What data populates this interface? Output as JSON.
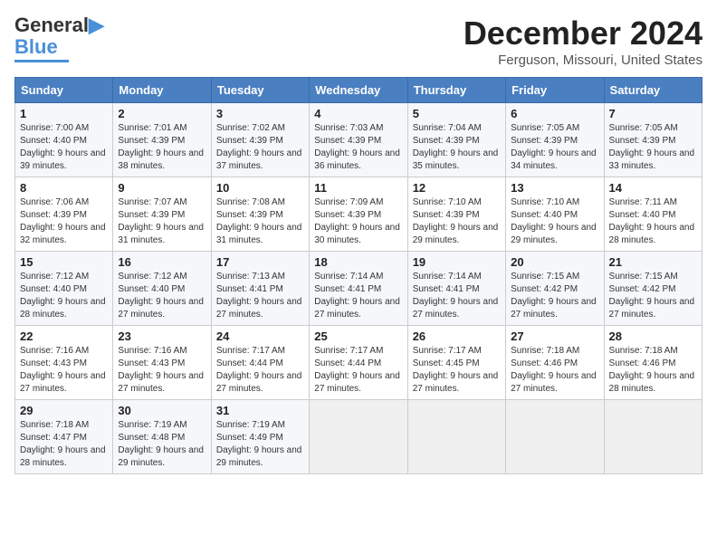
{
  "header": {
    "logo_line1": "General",
    "logo_line2": "Blue",
    "month_title": "December 2024",
    "location": "Ferguson, Missouri, United States"
  },
  "days_of_week": [
    "Sunday",
    "Monday",
    "Tuesday",
    "Wednesday",
    "Thursday",
    "Friday",
    "Saturday"
  ],
  "weeks": [
    [
      {
        "day": "1",
        "sunrise": "7:00 AM",
        "sunset": "4:40 PM",
        "daylight": "9 hours and 39 minutes."
      },
      {
        "day": "2",
        "sunrise": "7:01 AM",
        "sunset": "4:39 PM",
        "daylight": "9 hours and 38 minutes."
      },
      {
        "day": "3",
        "sunrise": "7:02 AM",
        "sunset": "4:39 PM",
        "daylight": "9 hours and 37 minutes."
      },
      {
        "day": "4",
        "sunrise": "7:03 AM",
        "sunset": "4:39 PM",
        "daylight": "9 hours and 36 minutes."
      },
      {
        "day": "5",
        "sunrise": "7:04 AM",
        "sunset": "4:39 PM",
        "daylight": "9 hours and 35 minutes."
      },
      {
        "day": "6",
        "sunrise": "7:05 AM",
        "sunset": "4:39 PM",
        "daylight": "9 hours and 34 minutes."
      },
      {
        "day": "7",
        "sunrise": "7:05 AM",
        "sunset": "4:39 PM",
        "daylight": "9 hours and 33 minutes."
      }
    ],
    [
      {
        "day": "8",
        "sunrise": "7:06 AM",
        "sunset": "4:39 PM",
        "daylight": "9 hours and 32 minutes."
      },
      {
        "day": "9",
        "sunrise": "7:07 AM",
        "sunset": "4:39 PM",
        "daylight": "9 hours and 31 minutes."
      },
      {
        "day": "10",
        "sunrise": "7:08 AM",
        "sunset": "4:39 PM",
        "daylight": "9 hours and 31 minutes."
      },
      {
        "day": "11",
        "sunrise": "7:09 AM",
        "sunset": "4:39 PM",
        "daylight": "9 hours and 30 minutes."
      },
      {
        "day": "12",
        "sunrise": "7:10 AM",
        "sunset": "4:39 PM",
        "daylight": "9 hours and 29 minutes."
      },
      {
        "day": "13",
        "sunrise": "7:10 AM",
        "sunset": "4:40 PM",
        "daylight": "9 hours and 29 minutes."
      },
      {
        "day": "14",
        "sunrise": "7:11 AM",
        "sunset": "4:40 PM",
        "daylight": "9 hours and 28 minutes."
      }
    ],
    [
      {
        "day": "15",
        "sunrise": "7:12 AM",
        "sunset": "4:40 PM",
        "daylight": "9 hours and 28 minutes."
      },
      {
        "day": "16",
        "sunrise": "7:12 AM",
        "sunset": "4:40 PM",
        "daylight": "9 hours and 27 minutes."
      },
      {
        "day": "17",
        "sunrise": "7:13 AM",
        "sunset": "4:41 PM",
        "daylight": "9 hours and 27 minutes."
      },
      {
        "day": "18",
        "sunrise": "7:14 AM",
        "sunset": "4:41 PM",
        "daylight": "9 hours and 27 minutes."
      },
      {
        "day": "19",
        "sunrise": "7:14 AM",
        "sunset": "4:41 PM",
        "daylight": "9 hours and 27 minutes."
      },
      {
        "day": "20",
        "sunrise": "7:15 AM",
        "sunset": "4:42 PM",
        "daylight": "9 hours and 27 minutes."
      },
      {
        "day": "21",
        "sunrise": "7:15 AM",
        "sunset": "4:42 PM",
        "daylight": "9 hours and 27 minutes."
      }
    ],
    [
      {
        "day": "22",
        "sunrise": "7:16 AM",
        "sunset": "4:43 PM",
        "daylight": "9 hours and 27 minutes."
      },
      {
        "day": "23",
        "sunrise": "7:16 AM",
        "sunset": "4:43 PM",
        "daylight": "9 hours and 27 minutes."
      },
      {
        "day": "24",
        "sunrise": "7:17 AM",
        "sunset": "4:44 PM",
        "daylight": "9 hours and 27 minutes."
      },
      {
        "day": "25",
        "sunrise": "7:17 AM",
        "sunset": "4:44 PM",
        "daylight": "9 hours and 27 minutes."
      },
      {
        "day": "26",
        "sunrise": "7:17 AM",
        "sunset": "4:45 PM",
        "daylight": "9 hours and 27 minutes."
      },
      {
        "day": "27",
        "sunrise": "7:18 AM",
        "sunset": "4:46 PM",
        "daylight": "9 hours and 27 minutes."
      },
      {
        "day": "28",
        "sunrise": "7:18 AM",
        "sunset": "4:46 PM",
        "daylight": "9 hours and 28 minutes."
      }
    ],
    [
      {
        "day": "29",
        "sunrise": "7:18 AM",
        "sunset": "4:47 PM",
        "daylight": "9 hours and 28 minutes."
      },
      {
        "day": "30",
        "sunrise": "7:19 AM",
        "sunset": "4:48 PM",
        "daylight": "9 hours and 29 minutes."
      },
      {
        "day": "31",
        "sunrise": "7:19 AM",
        "sunset": "4:49 PM",
        "daylight": "9 hours and 29 minutes."
      },
      null,
      null,
      null,
      null
    ]
  ]
}
